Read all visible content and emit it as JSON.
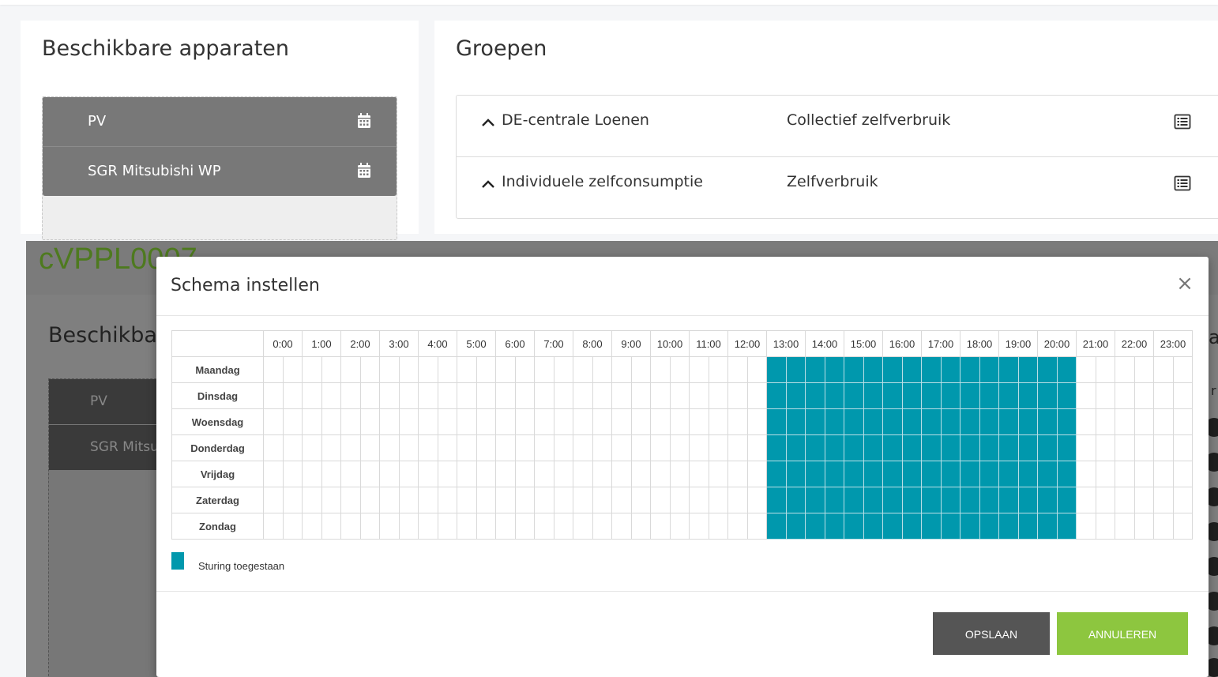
{
  "top": {
    "devices": {
      "title": "Beschikbare apparaten",
      "items": [
        {
          "label": "PV",
          "icon": "calendar-icon"
        },
        {
          "label": "SGR Mitsubishi WP",
          "icon": "calendar-icon"
        }
      ]
    },
    "groups": {
      "title": "Groepen",
      "rows": [
        {
          "name": "DE-centrale Loenen",
          "type": "Collectief zelfverbruik",
          "icon": "list-icon"
        },
        {
          "name": "Individuele zelfconsumptie",
          "type": "Zelfverbruik",
          "icon": "list-icon"
        }
      ]
    }
  },
  "background": {
    "logo": "cVPPL0007",
    "title": "Beschikbare",
    "devices": [
      "PV",
      "SGR Mitsu"
    ],
    "right_letter": "a",
    "right_small": "r"
  },
  "modal": {
    "title": "Schema instellen",
    "close_icon": "close-icon",
    "hours": [
      "0:00",
      "1:00",
      "2:00",
      "3:00",
      "4:00",
      "5:00",
      "6:00",
      "7:00",
      "8:00",
      "9:00",
      "10:00",
      "11:00",
      "12:00",
      "13:00",
      "14:00",
      "15:00",
      "16:00",
      "17:00",
      "18:00",
      "19:00",
      "20:00",
      "21:00",
      "22:00",
      "23:00"
    ],
    "days": [
      "Maandag",
      "Dinsdag",
      "Woensdag",
      "Donderdag",
      "Vrijdag",
      "Zaterdag",
      "Zondag"
    ],
    "slots_per_hour": 2,
    "allowed_from_hour": 13,
    "allowed_to_hour": 21,
    "legend": "Sturing toegestaan",
    "save_label": "OPSLAAN",
    "cancel_label": "ANNULEREN",
    "colors": {
      "allowed": "#0098ad",
      "save": "#555555",
      "cancel": "#8dc63f"
    }
  }
}
